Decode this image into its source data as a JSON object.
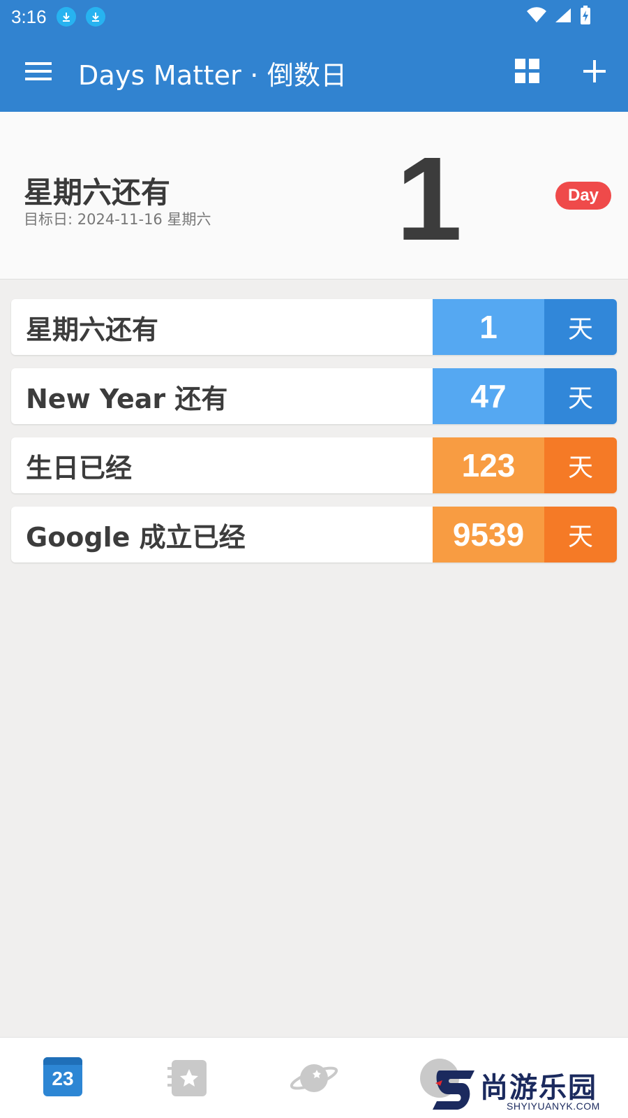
{
  "status_bar": {
    "time": "3:16",
    "icons": [
      "download-icon",
      "download-icon",
      "wifi-icon",
      "signal-icon",
      "battery-charging-icon"
    ]
  },
  "app_bar": {
    "title": "Days Matter · 倒数日",
    "menu_icon": "menu-icon",
    "grid_icon": "grid-icon",
    "add_icon": "plus-icon"
  },
  "hero": {
    "title": "星期六还有",
    "subtitle": "目标日: 2024-11-16 星期六",
    "number": "1",
    "badge": "Day"
  },
  "events": [
    {
      "label": "星期六还有",
      "days": "1",
      "unit": "天",
      "kind": "countdown",
      "num_color": "#55a8f2",
      "unit_color": "#3187d9"
    },
    {
      "label": "New Year 还有",
      "days": "47",
      "unit": "天",
      "kind": "countdown",
      "num_color": "#55a8f2",
      "unit_color": "#3187d9"
    },
    {
      "label": "生日已经",
      "days": "123",
      "unit": "天",
      "kind": "elapsed",
      "num_color": "#f89c42",
      "unit_color": "#f57a26"
    },
    {
      "label": "Google 成立已经",
      "days": "9539",
      "unit": "天",
      "kind": "elapsed",
      "num_color": "#f89c42",
      "unit_color": "#f57a26"
    }
  ],
  "bottom_nav": {
    "calendar_day": "23",
    "items": [
      "calendar-icon",
      "favorites-icon",
      "planet-icon",
      "profile-icon"
    ]
  },
  "watermark": {
    "text": "尚游乐园",
    "url_text": "SHYIYUANYK.COM"
  }
}
